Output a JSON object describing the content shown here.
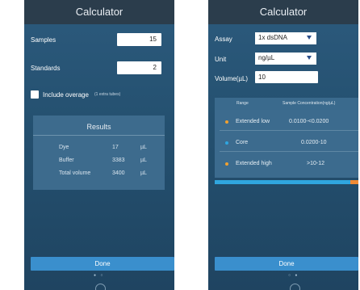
{
  "left_screen": {
    "title": "Calculator",
    "samples_label": "Samples",
    "samples_value": "15",
    "standards_label": "Standards",
    "standards_value": "2",
    "overage_label": "Include overage",
    "overage_note": "(1 extra tubes)",
    "results": {
      "title": "Results",
      "rows": [
        {
          "name": "Dye",
          "value": "17",
          "unit": "µL"
        },
        {
          "name": "Buffer",
          "value": "3383",
          "unit": "µL"
        },
        {
          "name": "Total volume",
          "value": "3400",
          "unit": "µL"
        }
      ]
    },
    "done_label": "Done",
    "dots": "● ○"
  },
  "right_screen": {
    "title": "Calculator",
    "assay_label": "Assay",
    "assay_value": "1x dsDNA",
    "unit_label": "Unit",
    "unit_value": "ng/µL",
    "volume_label": "Volume(µL)",
    "volume_value": "10",
    "table": {
      "range_header": "Range",
      "conc_header": "Sample Concentration(ng/µL)",
      "rows": [
        {
          "range": "Extended low",
          "conc": "0.0100-<0.0200",
          "dot_color": "#f0a030"
        },
        {
          "range": "Core",
          "conc": "0.0200-10",
          "dot_color": "#2ea6e0"
        },
        {
          "range": "Extended high",
          "conc": ">10-12",
          "dot_color": "#f0a030"
        }
      ]
    },
    "done_label": "Done",
    "dots": "○ ●"
  }
}
